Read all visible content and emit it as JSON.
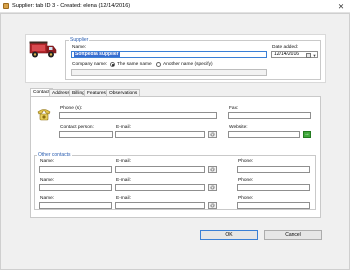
{
  "window": {
    "title": "Supplier: tab ID 3 - Created: elena (12/14/2016)",
    "close_glyph": "✕"
  },
  "supplier": {
    "legend": "Supplier",
    "name_label": "Name:",
    "name_value": "Softpedia supplier",
    "date_label": "Date added:",
    "date_value": "12/14/2016",
    "company_label": "Company name:",
    "same_name_label": "The same name",
    "another_name_label": "Another name (specify)",
    "company_value": ""
  },
  "tabs": [
    "Contact",
    "Address",
    "Billing",
    "Features",
    "Observations"
  ],
  "contact": {
    "phone_label": "Phone (s):",
    "fax_label": "Fax:",
    "contact_person_label": "Contact person:",
    "email_label": "E-mail:",
    "website_label": "Website:",
    "at_glyph": "@",
    "go_glyph": "→"
  },
  "other_contacts": {
    "legend": "Other contacts",
    "name_label": "Name:",
    "email_label": "E-mail:",
    "phone_label": "Phone:",
    "at_glyph": "@"
  },
  "buttons": {
    "ok": "OK",
    "cancel": "Cancel"
  },
  "icons": {
    "logo": "vintage-delivery-truck",
    "contact": "telephone-icon",
    "calendar": "calendar-icon"
  },
  "colors": {
    "accent": "#3a7fd5",
    "legend": "#2a5db0",
    "go": "#3fa83a",
    "truck_red": "#b3262b"
  }
}
